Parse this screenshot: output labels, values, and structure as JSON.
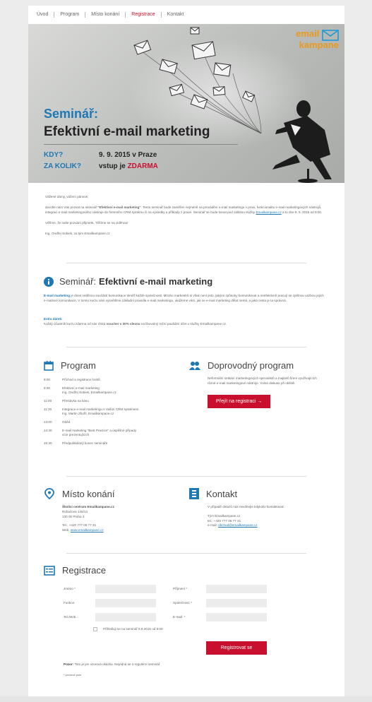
{
  "nav": {
    "items": [
      {
        "label": "Úvod",
        "active": false
      },
      {
        "label": "Program",
        "active": false
      },
      {
        "label": "Místo konání",
        "active": false
      },
      {
        "label": "Registrace",
        "active": true
      },
      {
        "label": "Kontakt",
        "active": false
      }
    ]
  },
  "hero": {
    "logo_line1": "email",
    "logo_line2": "kampane",
    "title_part1": "Seminář:",
    "title_part2": "Efektivní e-mail marketing",
    "q_when": "KDY?",
    "a_when": "9. 9. 2015 v Praze",
    "q_price": "ZA KOLIK?",
    "a_price_prefix": "vstup je",
    "a_price_highlight": "ZDARMA"
  },
  "intro": {
    "greeting": "Vážené dámy, vážení pánové,",
    "body_a": "dovolte nám Vás pozvat na seminář",
    "body_strong": "\"Efektivní e-mail marketing\"",
    "body_b": ". Tento seminář bude zaměřen nejméně na provádění e-mail marketingu v praxi, funkcionalitu e-mail marketingových nástrojů, integraci e-mail marketingového nástroje do firemního CRM systému či na výsledky a příklady z praxe. Seminář se bude konat pod záštitou služby",
    "body_link": "Emailkampane.cz",
    "body_c": "a to dne 9. 9. 2015 od 9:00.",
    "closing": "Věříme, že naše pozvání přijmete. Těšíme se na viděnou!",
    "signature": "Ing. Ondřej Sobiek, za tým Emailkampane.cz"
  },
  "seminar": {
    "title_light": "Seminář:",
    "title_bold": "Efektivní e-mail marketing",
    "lead_strong": "E-mail marketing",
    "lead_text": "je dnes nedílnou součástí komunikace téměř každé společnosti. Mnoho marketérů si však není jisto, jakými způsoby komunikovat a neefektivně pracují se zpětnou vazbou jejich e-mailové komunikace. V tomto kurzu vám vysvětlíme základní pravidla e-mail marketingu, ukážeme vám, jak se e-mail marketing dělat nemá, a jaká cesta je ta správná.",
    "extra_title": "Extra dárek:",
    "extra_a": "Každý účastník kurzu zdarma od nás získá",
    "extra_strong": "voucher s 30% slevou",
    "extra_b": "na libovolný roční paušální účet u služby Emailkampane.cz."
  },
  "program": {
    "title": "Program",
    "rows": [
      {
        "time": "8:00",
        "desc": "Příchod a registrace hostů"
      },
      {
        "time": "8:30",
        "desc": "Efektivní e-mail marketing\nIng. Ondřej Sobiek, Emailkampane.cz"
      },
      {
        "time": "11:00",
        "desc": "Přestávka na kávu"
      },
      {
        "time": "11:30",
        "desc": "Integrace e-mail marketingu s Vaším CRM systémem\nIng. Martin Zbořil, Emailkampane.cz"
      },
      {
        "time": "13:00",
        "desc": "Oběd"
      },
      {
        "time": "14:30",
        "desc": "E-mail marketing \"Best Practice\" a úspěšné případy\nvíce prezentujících"
      },
      {
        "time": "15:30",
        "desc": "Předpokládaný konec semináře"
      }
    ]
  },
  "side_program": {
    "title": "Doprovodný program",
    "text": "Neformální setkání marketingových specialistů a majitelů firem využívajících různé e-mail marketingové nástroje. Volná diskuse při obědě.",
    "button": "Přejít na registraci →"
  },
  "venue": {
    "title": "Místo konání",
    "name": "Školící centrum Emailkampane.cz",
    "street": "Rohačova 145/14",
    "city": "130 00 Praha 3",
    "tel": "Tel.: +420 777 06 77 31",
    "web_label": "Web:",
    "web_link": "www.emailkampane.cz"
  },
  "contact": {
    "title": "Kontakt",
    "text": "V případě dotazů nás neváhejte kdykoliv kontaktovat:",
    "team": "Tým Emailkampane.cz",
    "tel": "tel.: +420 777 06 77 31",
    "email_label": "e-mail:",
    "email_link": "obchod@emailkampane.cz"
  },
  "registration": {
    "title": "Registrace",
    "fields": {
      "first_name": "Jméno *",
      "last_name": "Příjmení *",
      "role": "Funkce:",
      "company": "Společnost: *",
      "phone": "Tel./Mob.:",
      "email": "E-mail: *"
    },
    "checkbox_label": "Přihlašuji se na seminář 9.9.2015 od 9:00",
    "submit": "Registrovat se",
    "note_strong": "Pozor:",
    "note_text": "Toto je jen vzorová ukázka. Nejedná se o regulérní seminář.",
    "required_note": "* povinné pole"
  },
  "colors": {
    "accent_blue": "#1e78b4",
    "accent_red": "#c8102e",
    "logo_orange": "#e99a1c"
  }
}
